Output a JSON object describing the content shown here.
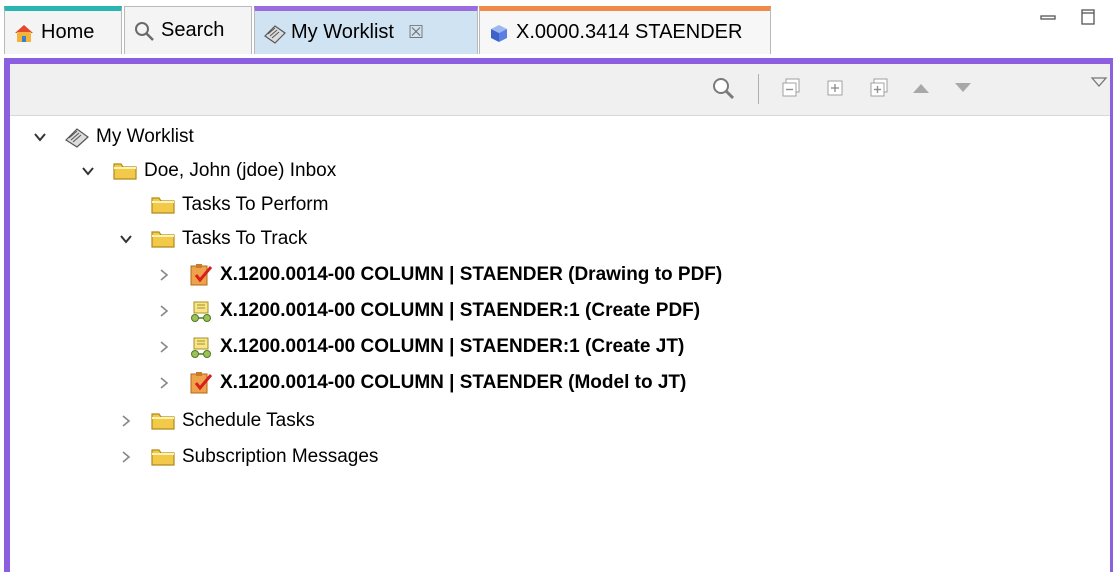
{
  "tabs": [
    {
      "label": "Home",
      "icon": "home-icon",
      "accent": "#2bb5b0"
    },
    {
      "label": "Search",
      "icon": "search-icon"
    },
    {
      "label": "My Worklist",
      "icon": "worklist-icon",
      "close": "☒",
      "accent": "#9b6cdd"
    },
    {
      "label": "X.0000.3414 STAENDER",
      "icon": "item-cube-icon",
      "accent": "#f08a4b"
    }
  ],
  "window_controls": {
    "minimize": "minimize-icon",
    "maximize": "maximize-icon"
  },
  "toolbar": {
    "icons": [
      "search-icon",
      "collapse-all-icon",
      "expand-icon",
      "expand-all-icon",
      "move-up-icon",
      "move-down-icon",
      "view-menu-icon"
    ]
  },
  "tree": {
    "root": "My Worklist",
    "inbox": "Doe, John (jdoe) Inbox",
    "tasks_to_perform": "Tasks To Perform",
    "tasks_to_track": "Tasks To Track",
    "tracked_tasks": [
      {
        "label": "X.1200.0014-00 COLUMN | STAENDER (Drawing to PDF)",
        "icon": "task-checked-icon"
      },
      {
        "label": "X.1200.0014-00 COLUMN | STAENDER:1 (Create PDF)",
        "icon": "task-process-icon"
      },
      {
        "label": "X.1200.0014-00 COLUMN | STAENDER:1 (Create JT)",
        "icon": "task-process-icon"
      },
      {
        "label": "X.1200.0014-00 COLUMN | STAENDER (Model to JT)",
        "icon": "task-checked-icon"
      }
    ],
    "schedule_tasks": "Schedule Tasks",
    "subscription_messages": "Subscription Messages"
  },
  "colors": {
    "panel_border": "#8c5fe0",
    "active_tab": "#cfe3f3",
    "folder": "#f3c94a"
  }
}
